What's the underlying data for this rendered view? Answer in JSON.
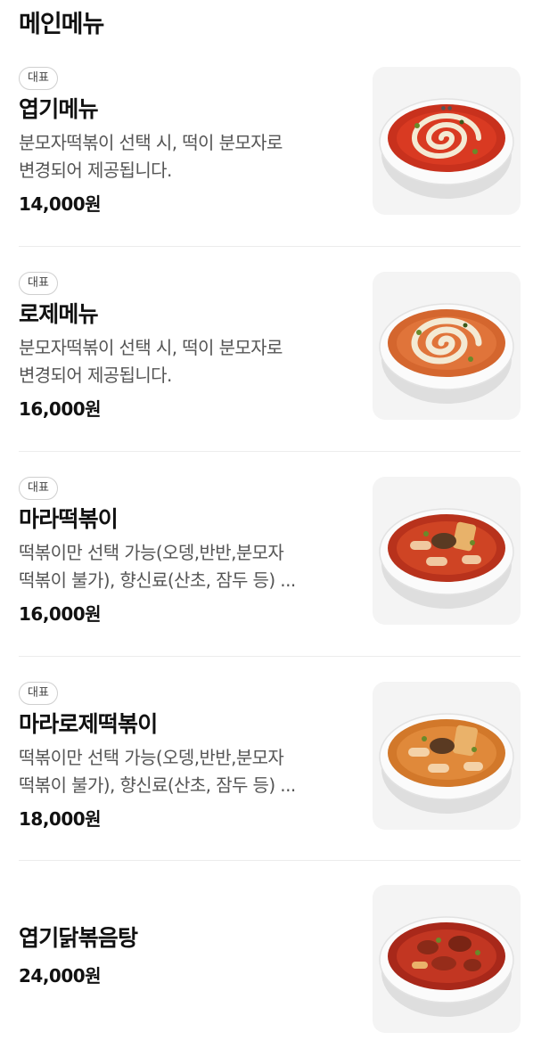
{
  "section": {
    "title": "메인메뉴"
  },
  "menu": {
    "items": [
      {
        "badge": "대표",
        "name": "엽기메뉴",
        "desc_line1": "분모자떡볶이 선택 시, 떡이 분모자로",
        "desc_line2": "변경되어 제공됩니다.",
        "price": "14,000원",
        "image": "rose-tteokbokki-bowl-spicy"
      },
      {
        "badge": "대표",
        "name": "로제메뉴",
        "desc_line1": "분모자떡볶이 선택 시, 떡이 분모자로",
        "desc_line2": "변경되어 제공됩니다.",
        "price": "16,000원",
        "image": "rose-tteokbokki-bowl-cream"
      },
      {
        "badge": "대표",
        "name": "마라떡볶이",
        "desc_line1": "떡볶이만 선택 가능(오뎅,반반,분모자",
        "desc_line2": "떡볶이 불가), 향신료(산초, 잠두 등) ...",
        "price": "16,000원",
        "image": "mala-tteokbokki-bowl"
      },
      {
        "badge": "대표",
        "name": "마라로제떡볶이",
        "desc_line1": "떡볶이만 선택 가능(오뎅,반반,분모자",
        "desc_line2": "떡볶이 불가), 향신료(산초, 잠두 등) ...",
        "price": "18,000원",
        "image": "mala-rose-tteokbokki-bowl"
      },
      {
        "name": "엽기닭볶음탕",
        "price": "24,000원",
        "image": "braised-spicy-chicken-bowl"
      }
    ]
  },
  "colors": {
    "spicy_sauce": "#d93a22",
    "rose_sauce": "#e0743a",
    "cream": "#f3ead4",
    "bowl": "#f7f7f7",
    "thumb_bg": "#f4f4f4"
  }
}
